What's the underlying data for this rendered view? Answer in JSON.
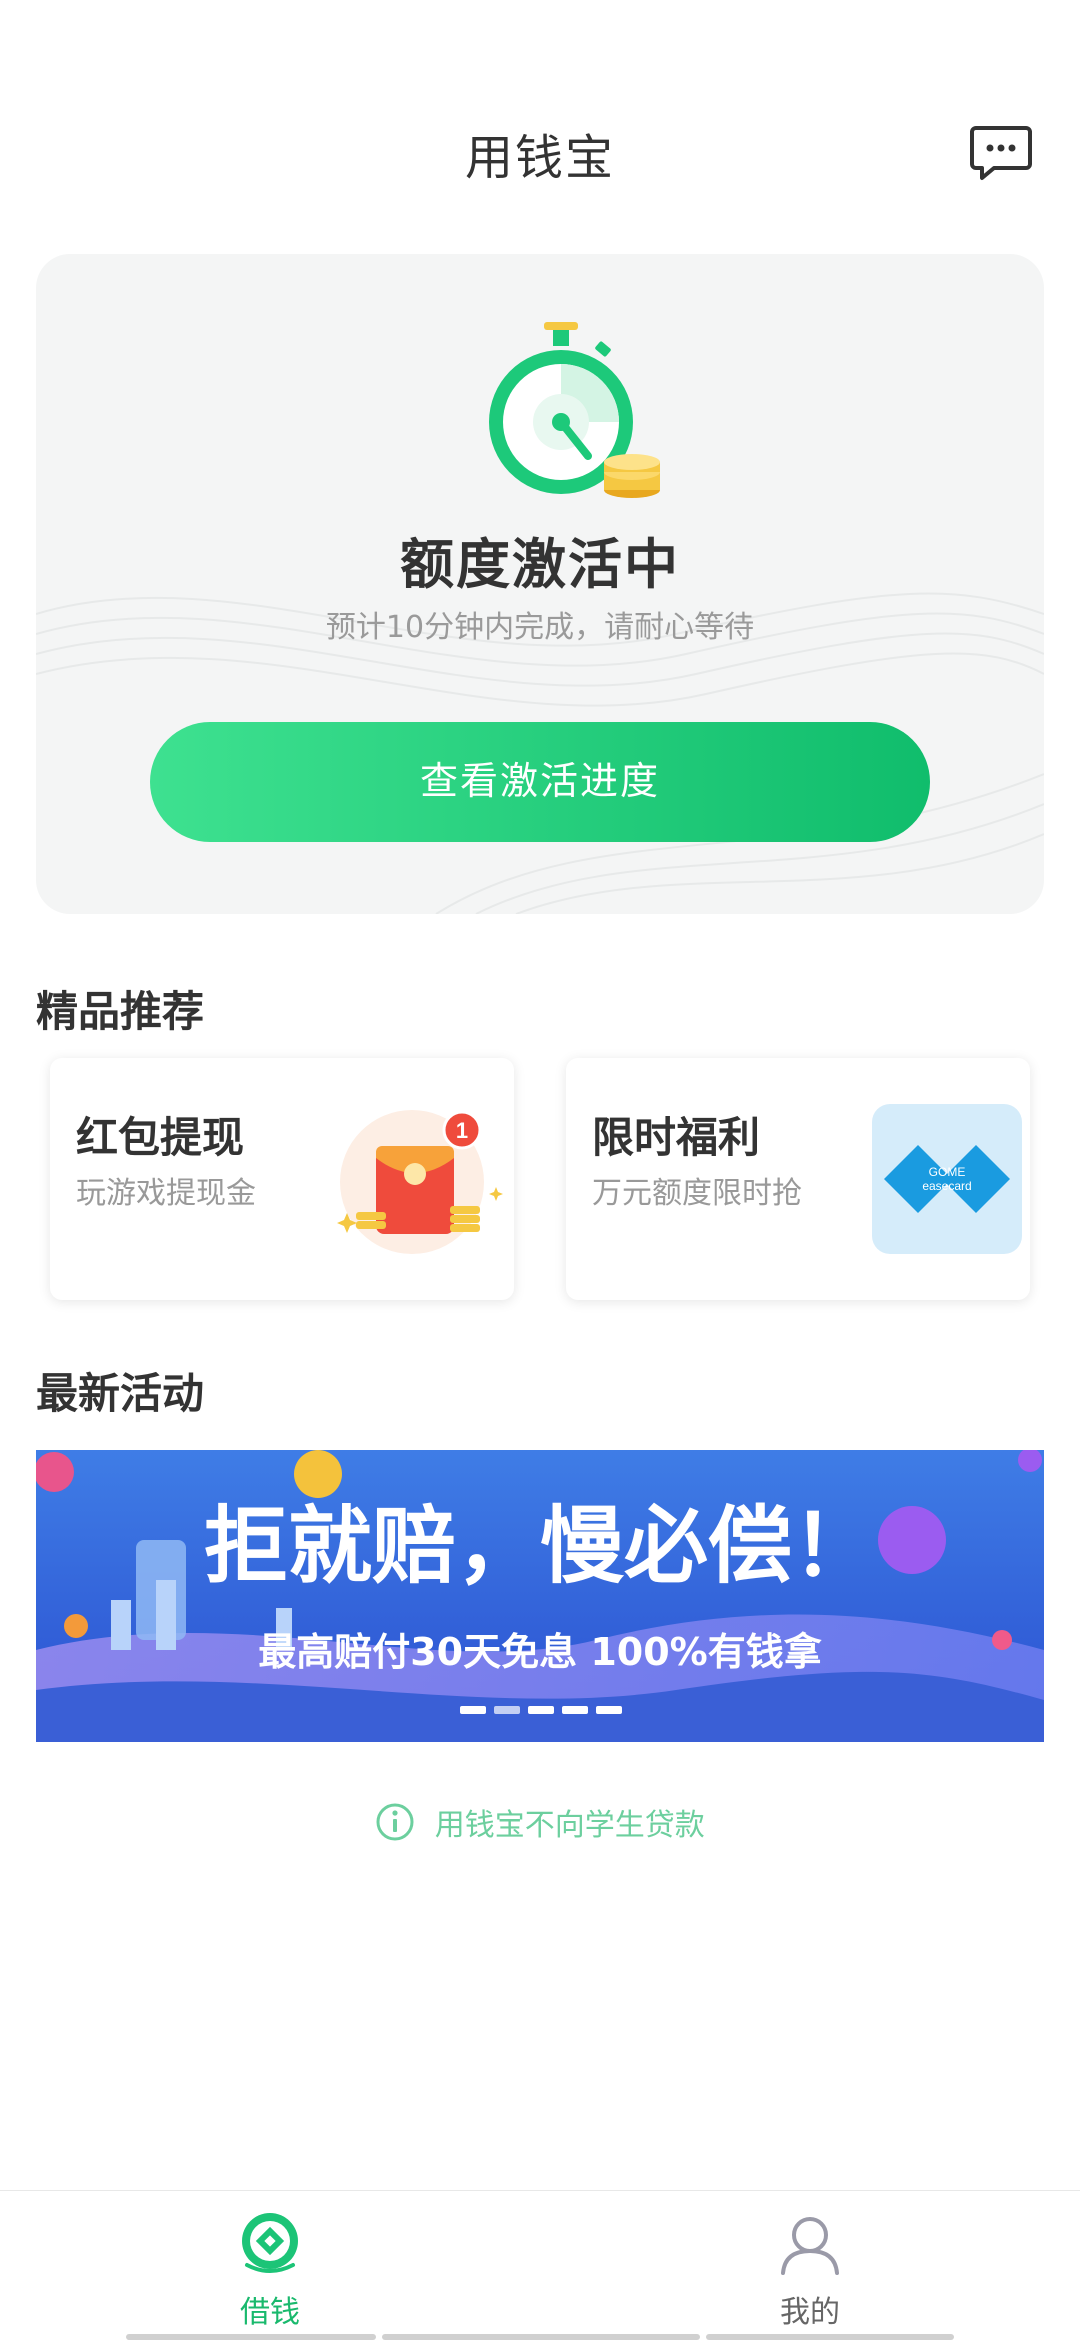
{
  "header": {
    "title": "用钱宝",
    "message_icon": "chat-bubble-icon"
  },
  "status_card": {
    "title": "额度激活中",
    "subtitle": "预计10分钟内完成，请耐心等待",
    "button_label": "查看激活进度",
    "icon": "stopwatch-icon",
    "accent_color": "#1dc97a"
  },
  "recommend": {
    "section_title": "精品推荐",
    "items": [
      {
        "title": "红包提现",
        "subtitle": "玩游戏提现金",
        "icon": "red-envelope-icon",
        "badge": "1"
      },
      {
        "title": "限时福利",
        "subtitle": "万元额度限时抢",
        "icon": "gome-easecard-logo",
        "logo_text_1": "GOME",
        "logo_text_2": "easecard"
      }
    ]
  },
  "activities": {
    "section_title": "最新活动",
    "banner": {
      "headline": "拒就赔，慢必偿！",
      "subline": "最高赔付30天免息 100%有钱拿"
    }
  },
  "notice": {
    "text": "用钱宝不向学生贷款",
    "icon": "info-icon"
  },
  "tabbar": {
    "items": [
      {
        "label": "借钱",
        "icon": "borrow-icon",
        "active": true
      },
      {
        "label": "我的",
        "icon": "user-icon",
        "active": false
      }
    ]
  }
}
